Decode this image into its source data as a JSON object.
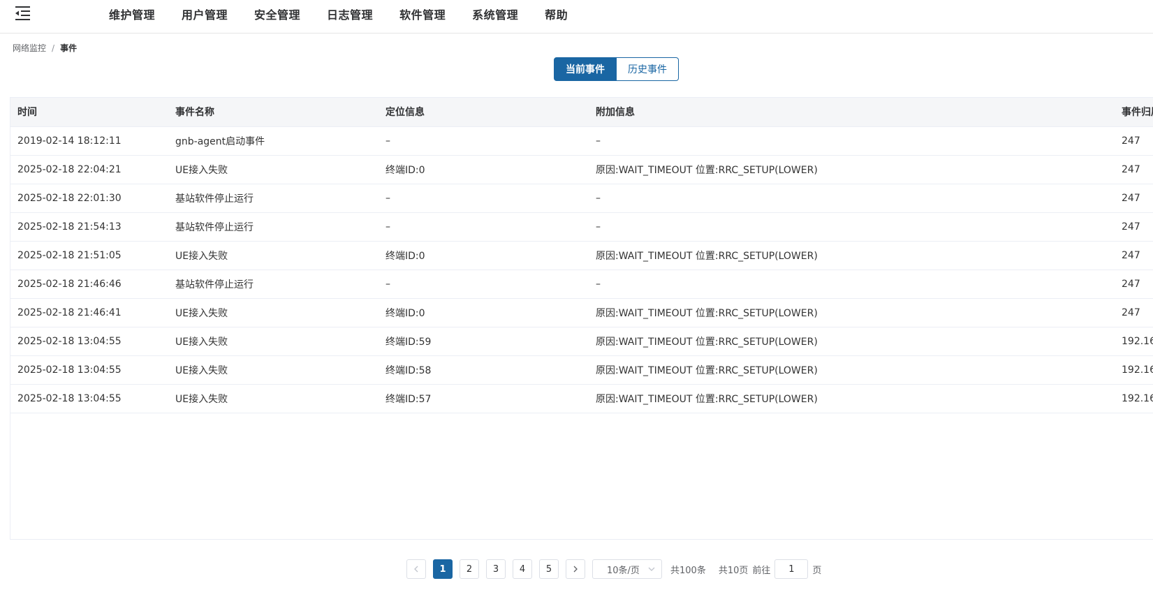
{
  "nav": {
    "items": [
      "维护管理",
      "用户管理",
      "安全管理",
      "日志管理",
      "软件管理",
      "系统管理",
      "帮助"
    ]
  },
  "breadcrumb": {
    "parent": "网络监控",
    "separator": "/",
    "current": "事件"
  },
  "tabs": {
    "current_label": "当前事件",
    "history_label": "历史事件"
  },
  "table": {
    "headers": [
      "时间",
      "事件名称",
      "定位信息",
      "附加信息",
      "事件归属"
    ],
    "rows": [
      [
        "2019-02-14 18:12:11",
        "gnb-agent启动事件",
        "–",
        "–",
        "247"
      ],
      [
        "2025-02-18 22:04:21",
        "UE接入失败",
        "终端ID:0",
        "原因:WAIT_TIMEOUT 位置:RRC_SETUP(LOWER)",
        "247"
      ],
      [
        "2025-02-18 22:01:30",
        "基站软件停止运行",
        "–",
        "–",
        "247"
      ],
      [
        "2025-02-18 21:54:13",
        "基站软件停止运行",
        "–",
        "–",
        "247"
      ],
      [
        "2025-02-18 21:51:05",
        "UE接入失败",
        "终端ID:0",
        "原因:WAIT_TIMEOUT 位置:RRC_SETUP(LOWER)",
        "247"
      ],
      [
        "2025-02-18 21:46:46",
        "基站软件停止运行",
        "–",
        "–",
        "247"
      ],
      [
        "2025-02-18 21:46:41",
        "UE接入失败",
        "终端ID:0",
        "原因:WAIT_TIMEOUT 位置:RRC_SETUP(LOWER)",
        "247"
      ],
      [
        "2025-02-18 13:04:55",
        "UE接入失败",
        "终端ID:59",
        "原因:WAIT_TIMEOUT 位置:RRC_SETUP(LOWER)",
        "192.16"
      ],
      [
        "2025-02-18 13:04:55",
        "UE接入失败",
        "终端ID:58",
        "原因:WAIT_TIMEOUT 位置:RRC_SETUP(LOWER)",
        "192.16"
      ],
      [
        "2025-02-18 13:04:55",
        "UE接入失败",
        "终端ID:57",
        "原因:WAIT_TIMEOUT 位置:RRC_SETUP(LOWER)",
        "192.16"
      ]
    ]
  },
  "pagination": {
    "pages": [
      "1",
      "2",
      "3",
      "4",
      "5"
    ],
    "current_page": "1",
    "page_size": "10条/页",
    "total": "共100条",
    "total_pages": "共10页",
    "goto_label": "前往",
    "goto_value": "1",
    "page_suffix": "页"
  },
  "colors": {
    "primary": "#1a66a3",
    "header_bg": "#f5f6f8",
    "border": "#ebeef5"
  },
  "icons": {
    "menu_toggle": "menu-fold-icon",
    "prev": "chevron-left-icon",
    "next": "chevron-right-icon",
    "dropdown": "chevron-down-icon"
  }
}
